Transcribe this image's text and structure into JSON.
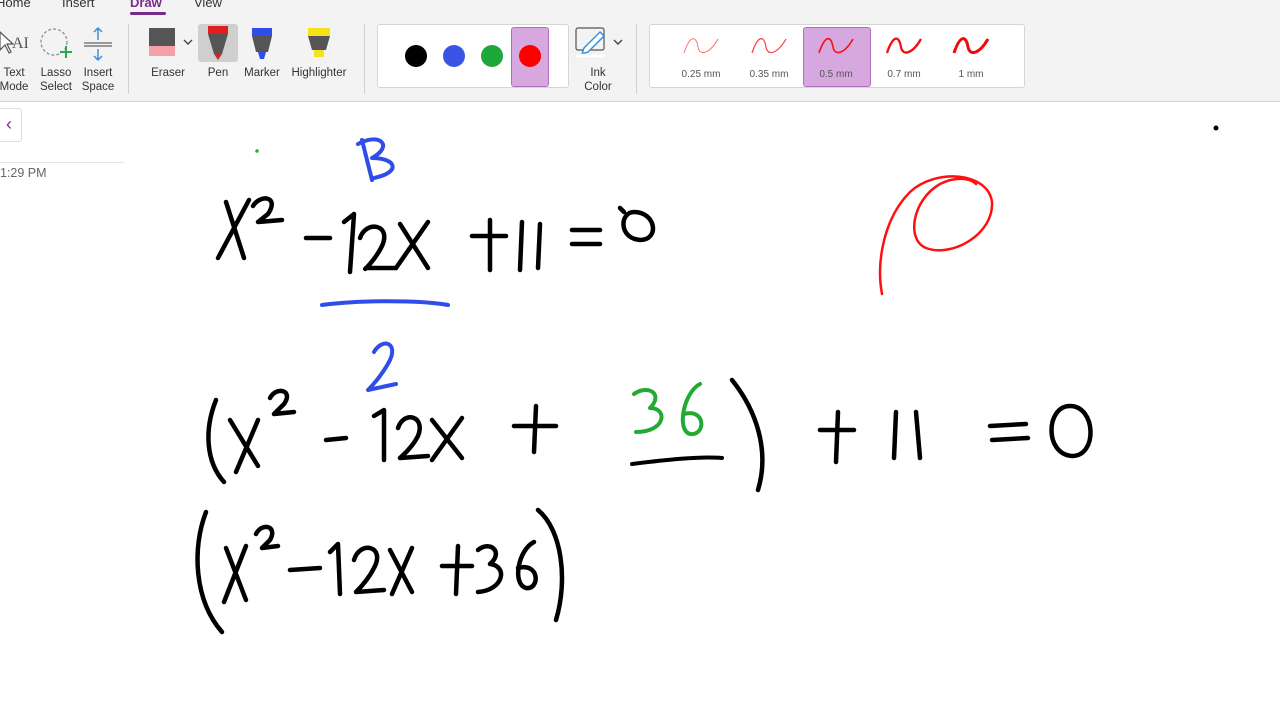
{
  "tabs": {
    "home": "Home",
    "insert": "Insert",
    "draw": "Draw",
    "view": "View"
  },
  "tools": {
    "text_mode": [
      "Text",
      "Mode"
    ],
    "lasso": [
      "Lasso",
      "Select"
    ],
    "insert_space": [
      "Insert",
      "Space"
    ],
    "eraser": "Eraser",
    "pen": "Pen",
    "marker": "Marker",
    "highlighter": "Highlighter",
    "ink_color": [
      "Ink",
      "Color"
    ]
  },
  "pen_colors": [
    "#000000",
    "#3a55e6",
    "#1fa83a",
    "#ff0000"
  ],
  "selected_color": "#ff0000",
  "thickness": [
    "0.25 mm",
    "0.35 mm",
    "0.5 mm",
    "0.7 mm",
    "1 mm"
  ],
  "selected_thickness": "0.5 mm",
  "page": {
    "time": "1:29 PM"
  },
  "ink_colors": {
    "black": "#000000",
    "blue": "#2f4de8",
    "green": "#22aa33",
    "red": "#ff1010"
  }
}
